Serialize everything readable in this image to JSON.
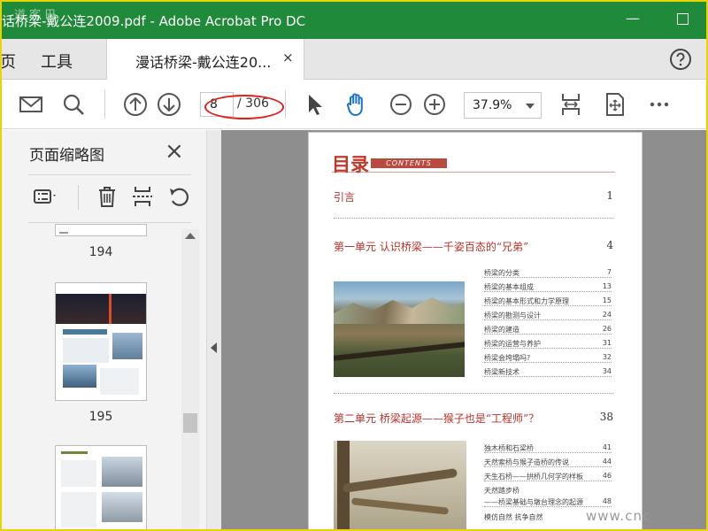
{
  "window": {
    "title": "话桥梁-戴公连2009.pdf - Adobe Acrobat Pro DC",
    "minimize_glyph": "—",
    "watermark_top": "道 客 巴",
    "watermark_bottom": "www.cnc"
  },
  "tabs": {
    "home": "页",
    "tools": "工具",
    "document": "漫话桥梁-戴公连20...",
    "close": "×"
  },
  "toolbar": {
    "page_current": "8",
    "page_total": "/ 306",
    "zoom": "37.9%",
    "icons": [
      "mail-icon",
      "search-icon",
      "page-up-icon",
      "page-down-icon",
      "select-pointer-icon",
      "hand-tool-icon",
      "zoom-out-icon",
      "zoom-in-icon",
      "fit-page-icon",
      "full-screen-icon",
      "more-icon"
    ]
  },
  "thumbnail_panel": {
    "title": "页面缩略图",
    "close": "×",
    "pages": [
      "194",
      "195"
    ]
  },
  "document_page": {
    "toc_title": "目录",
    "toc_banner": "CONTENTS",
    "entries": [
      {
        "text": "引言",
        "page": "1"
      },
      {
        "text": "第一单元  认识桥梁——千姿百态的“兄弟”",
        "page": "4"
      },
      {
        "text": "第二单元  桥梁起源——猴子也是“工程师”？",
        "page": "38"
      }
    ],
    "unit1_items": [
      {
        "text": "桥梁的分类",
        "page": "7"
      },
      {
        "text": "桥梁的基本组成",
        "page": "13"
      },
      {
        "text": "桥梁的基本形式和力学原理",
        "page": "15"
      },
      {
        "text": "桥梁的勘测与设计",
        "page": "24"
      },
      {
        "text": "桥梁的建造",
        "page": "26"
      },
      {
        "text": "桥梁的运营与养护",
        "page": "31"
      },
      {
        "text": "桥梁会垮塌吗?",
        "page": "32"
      },
      {
        "text": "桥梁新技术",
        "page": "34"
      }
    ],
    "unit2_items": [
      {
        "text": "独木桥和石梁桥",
        "page": "41"
      },
      {
        "text": "天然索桥与猴子造桥的传说",
        "page": "44"
      },
      {
        "text": "天生石桥——拱桥几何学的样板",
        "page": "46"
      },
      {
        "text": "天然踏步桥",
        "page": ""
      },
      {
        "text": "——桥梁基础与墩台理念的起源",
        "page": "48"
      },
      {
        "text": "模仿自然  抗争自然",
        "page": ""
      }
    ]
  },
  "colors": {
    "titlebar": "#1f8a3a",
    "annotation_circle": "#e0201a",
    "toc_red": "#b8322a",
    "hand_tool_blue": "#1a73c8"
  }
}
